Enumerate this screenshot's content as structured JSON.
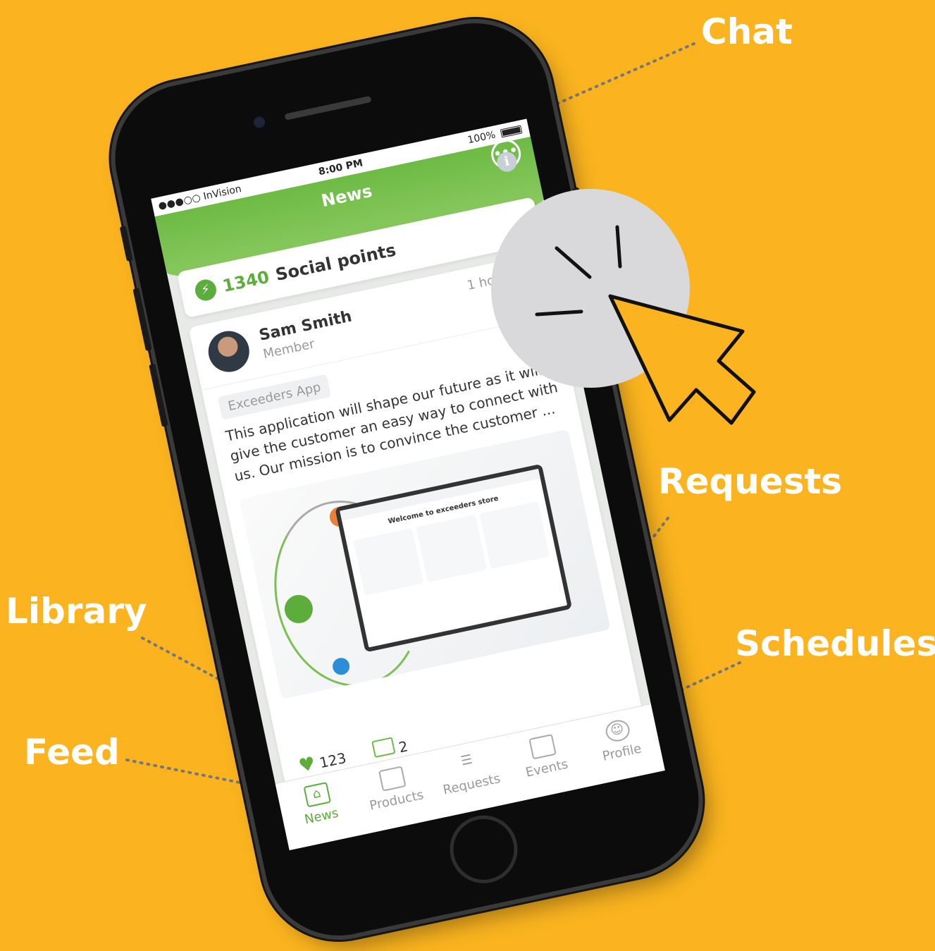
{
  "callouts": {
    "chat": "Chat",
    "requests": "Requests",
    "library": "Library",
    "schedules": "Schedules",
    "feed": "Feed"
  },
  "status_bar": {
    "carrier": "●●●○○ InVision",
    "time": "8:00 PM",
    "battery": "100%"
  },
  "header": {
    "title": "News",
    "chat_icon": "chat-bubble-icon"
  },
  "points": {
    "value": "1340",
    "label": "Social points",
    "icon": "bolt-icon"
  },
  "post": {
    "author": "Sam Smith",
    "role": "Member",
    "time": "1 hour ago",
    "tag": "Exceeders App",
    "text": "This application will shape our future as it will give the customer an easy way to connect with us. Our mission is to convince the customer ...",
    "image_caption": "Welcome to exceeders store",
    "likes": "123",
    "comments": "2"
  },
  "tabs": [
    {
      "label": "News",
      "icon": "home-icon",
      "active": true
    },
    {
      "label": "Products",
      "icon": "browser-window-icon",
      "active": false
    },
    {
      "label": "Requests",
      "icon": "list-icon",
      "active": false
    },
    {
      "label": "Events",
      "icon": "calendar-icon",
      "active": false
    },
    {
      "label": "Profile",
      "icon": "user-circle-icon",
      "active": false
    }
  ],
  "colors": {
    "background": "#FBB41F",
    "brand_green": "#6dbb45",
    "callout_text": "#ffffff",
    "click_indicator": "#d9d9db"
  }
}
